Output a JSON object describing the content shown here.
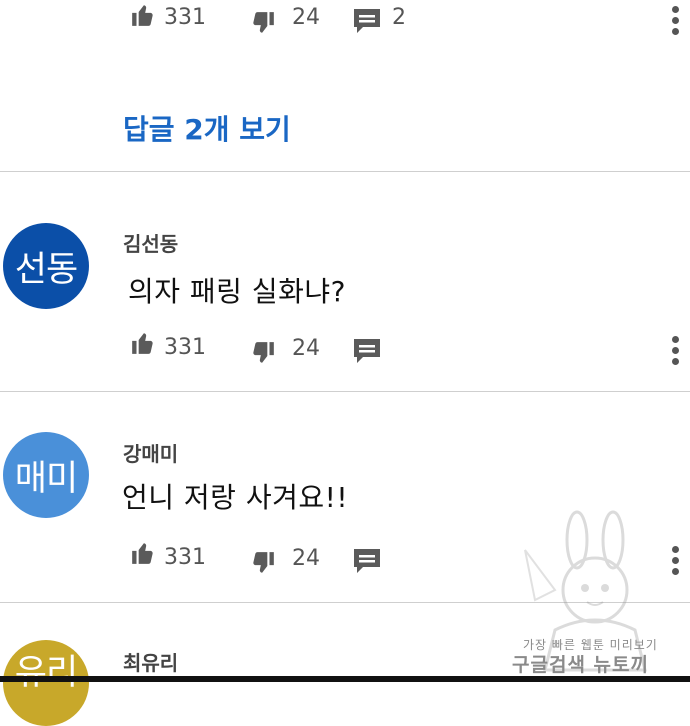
{
  "first_comment_actions": {
    "likes": "331",
    "dislikes": "24",
    "replies": "2"
  },
  "replies_link": "답글 2개 보기",
  "comments": [
    {
      "author": "김선동",
      "avatar_text": "선동",
      "avatar_color": "#0b4fa8",
      "text": "의자 패링 실화냐?",
      "likes": "331",
      "dislikes": "24"
    },
    {
      "author": "강매미",
      "avatar_text": "매미",
      "avatar_color": "#4a90d9",
      "text": "언니 저랑 사겨요!!",
      "likes": "331",
      "dislikes": "24"
    },
    {
      "author": "최유리",
      "avatar_text": "유리",
      "avatar_color": "#c8a82a"
    }
  ],
  "watermark": {
    "line1": "가장 빠른 웹툰 미리보기",
    "line2": "구글검색 뉴토끼"
  },
  "colors": {
    "link": "#1a67c4",
    "icon": "#555555",
    "divider": "#cfcfcf"
  }
}
